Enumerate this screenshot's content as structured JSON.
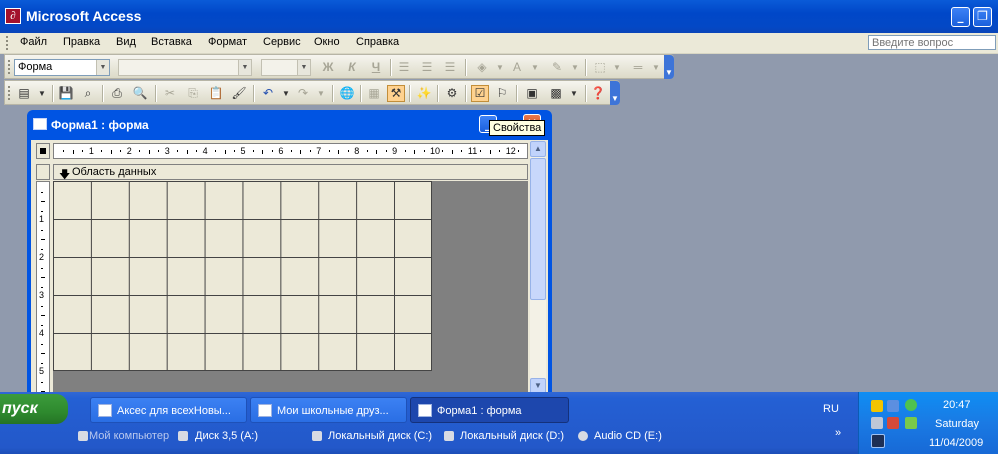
{
  "window": {
    "title": "Microsoft Access"
  },
  "menubar": {
    "items": [
      "Файл",
      "Правка",
      "Вид",
      "Вставка",
      "Формат",
      "Сервис",
      "Окно",
      "Справка"
    ],
    "help_placeholder": "Введите вопрос"
  },
  "toolbar_format": {
    "object_value": "Форма",
    "bold_label": "Ж",
    "italic_label": "К",
    "underline_label": "Ч"
  },
  "form_window": {
    "title": "Форма1 : форма",
    "tooltip": "Свойства",
    "section_label": "Область данных",
    "hruler_ticks": [
      "1",
      "2",
      "3",
      "4",
      "5",
      "6",
      "7",
      "8",
      "9",
      "10",
      "11",
      "12"
    ],
    "vruler_ticks": [
      "1",
      "2",
      "3",
      "4",
      "5"
    ]
  },
  "taskbar": {
    "start_label": "пуск",
    "tasks": [
      {
        "label": "Аксес для всехНовы..."
      },
      {
        "label": "Мои школьные друз..."
      },
      {
        "label": "Форма1 : форма"
      }
    ],
    "language": "RU",
    "quick_launch": [
      {
        "label": "Мой компьютер"
      },
      {
        "label": "Диск 3,5 (A:)"
      },
      {
        "label": "Локальный диск (C:)"
      },
      {
        "label": "Локальный диск (D:)"
      },
      {
        "label": "Audio CD (E:)"
      }
    ],
    "more": "»"
  },
  "clock": {
    "time": "20:47",
    "day": "Saturday",
    "date": "11/04/2009"
  },
  "colors": {
    "title_blue": "#0054e3",
    "taskbar_blue": "#245edb",
    "start_green": "#3c9b3c",
    "grid_beige": "#ece9d8",
    "tray_blue": "#0f8ef3"
  }
}
